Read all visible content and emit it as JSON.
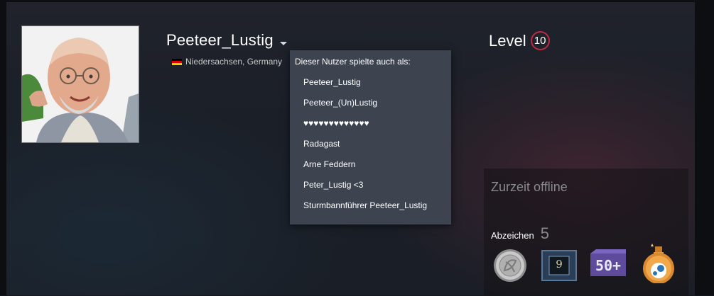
{
  "profile": {
    "persona_name": "Peeteer_Lustig",
    "location": "Niedersachsen, Germany",
    "level_label": "Level",
    "level_value": "10"
  },
  "aliases": {
    "title": "Dieser Nutzer spielte auch als:",
    "items": [
      "Peeteer_Lustig",
      "Peeteer_(Un)Lustig",
      "♥♥♥♥♥♥♥♥♥♥♥♥♥",
      "Radagast",
      "Arne Feddern",
      "Peter_Lustig <3",
      "Sturmbannführer Peeteer_Lustig"
    ]
  },
  "status_panel": {
    "status": "Zurzeit offline",
    "badges_label": "Abzeichen",
    "badges_count": "5",
    "badges": [
      {
        "icon": "silver-coin-badge-icon"
      },
      {
        "icon": "years-of-service-badge-icon",
        "text": "9"
      },
      {
        "icon": "game-collector-badge-icon",
        "text": "50+"
      },
      {
        "icon": "steam-potion-badge-icon"
      }
    ]
  },
  "colors": {
    "level_ring": "#c02942",
    "dropdown_bg": "#3d4450",
    "muted_text": "#898989"
  }
}
